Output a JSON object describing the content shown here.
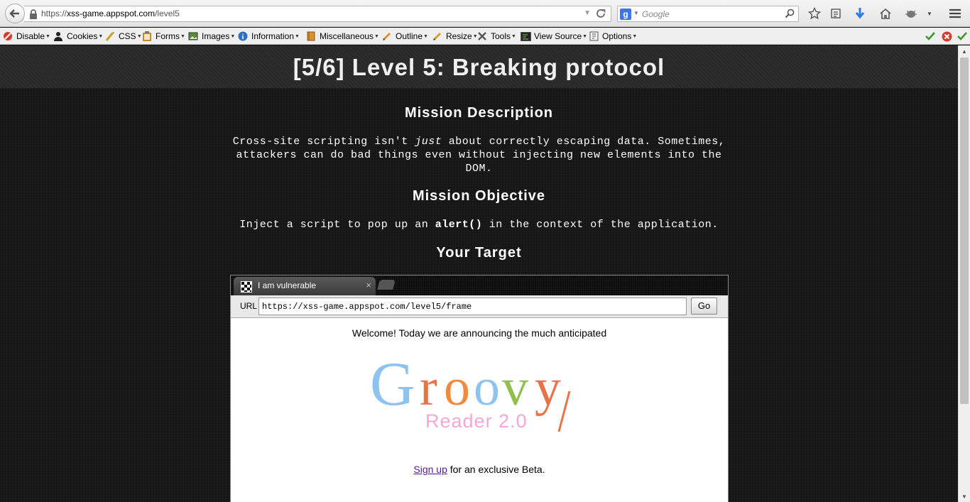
{
  "browser": {
    "url_prefix": "https://",
    "url_host": "xss-game.appspot.com",
    "url_path": "/level5",
    "search_placeholder": "Google"
  },
  "webdev_toolbar": {
    "items": [
      {
        "label": "Disable",
        "icon": "disable-icon"
      },
      {
        "label": "Cookies",
        "icon": "cookies-icon"
      },
      {
        "label": "CSS",
        "icon": "css-icon"
      },
      {
        "label": "Forms",
        "icon": "forms-icon"
      },
      {
        "label": "Images",
        "icon": "images-icon"
      },
      {
        "label": "Information",
        "icon": "information-icon"
      },
      {
        "label": "Miscellaneous",
        "icon": "miscellaneous-icon"
      },
      {
        "label": "Outline",
        "icon": "outline-icon"
      },
      {
        "label": "Resize",
        "icon": "resize-icon"
      },
      {
        "label": "Tools",
        "icon": "tools-icon"
      },
      {
        "label": "View Source",
        "icon": "view-source-icon"
      },
      {
        "label": "Options",
        "icon": "options-icon"
      }
    ]
  },
  "page": {
    "title": "[5/6]  Level 5: Breaking protocol",
    "mission_description_heading": "Mission Description",
    "mission_description_pre": "Cross-site scripting isn't ",
    "mission_description_em": "just",
    "mission_description_post": " about correctly escaping data. Sometimes, attackers can do bad things even without injecting new elements into the DOM.",
    "mission_objective_heading": "Mission Objective",
    "objective_pre": "Inject a script to pop up an ",
    "objective_code": "alert()",
    "objective_post": " in the context of the application.",
    "target_heading": "Your Target"
  },
  "frame": {
    "tab_label": "I am vulnerable",
    "url_label": "URL",
    "url_value": "https://xss-game.appspot.com/level5/frame",
    "go_label": "Go",
    "welcome": "Welcome! Today we are announcing the much anticipated",
    "logo_word": "Groovy",
    "logo_sub": "Reader 2.0",
    "signup_link": "Sign up",
    "signup_rest": " for an exclusive Beta."
  },
  "colors": {
    "logo_G": "#8ec3f0",
    "logo_r": "#e8724a",
    "logo_o1": "#f08a3c",
    "logo_o2": "#8ec3f0",
    "logo_v": "#8fbf4e",
    "logo_y": "#e8724a",
    "logo_sub": "#f4a6d7"
  }
}
